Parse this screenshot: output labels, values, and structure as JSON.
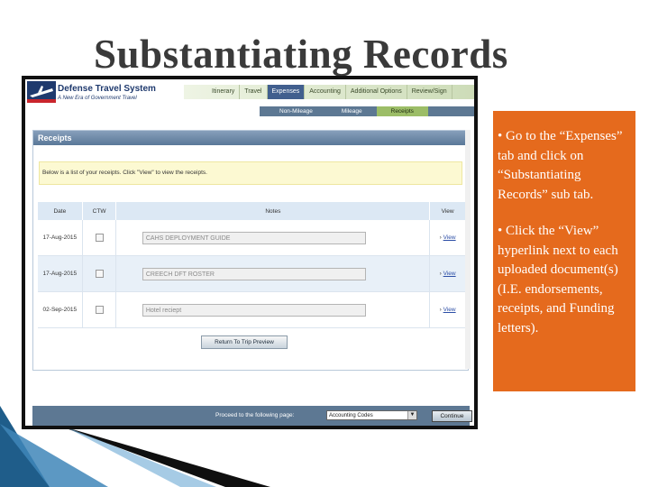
{
  "slide": {
    "title": "Substantiating Records",
    "bullets": [
      "• Go to the “Expenses” tab and click on “Substantiating Records” sub tab.",
      "• Click the “View” hyperlink next to each uploaded document(s) (I.E. endorsements, receipts, and Funding letters)."
    ],
    "colors": {
      "callout": "#e56a1d",
      "title": "#3a3a3a"
    }
  },
  "app": {
    "logo_title": "Defense Travel System",
    "logo_subtitle": "A New Era of Government Travel",
    "logo_icon": "dts-plane-logo-icon",
    "main_tabs": [
      "Itinerary",
      "Travel",
      "Expenses",
      "Accounting",
      "Additional Options",
      "Review/Sign"
    ],
    "main_tab_active": "Expenses",
    "sub_tabs": [
      "Non-Mileage",
      "Mileage",
      "Receipts"
    ],
    "sub_tab_active": "Receipts",
    "panel_title": "Receipts",
    "notice": "Below is a list of your receipts. Click \"View\" to view the receipts.",
    "table": {
      "headers": [
        "Date",
        "CTW",
        "Notes",
        "View"
      ],
      "rows": [
        {
          "date": "17-Aug-2015",
          "note": "CAHS DEPLOYMENT GUIDE",
          "view": "View"
        },
        {
          "date": "17-Aug-2015",
          "note": "CREECH DFT ROSTER",
          "view": "View"
        },
        {
          "date": "02-Sep-2015",
          "note": "Hotel reciept",
          "view": "View"
        }
      ]
    },
    "return_button": "Return To Trip Preview",
    "footer": {
      "proceed_label": "Proceed to the following page:",
      "select_value": "Accounting Codes",
      "continue_button": "Continue"
    }
  }
}
